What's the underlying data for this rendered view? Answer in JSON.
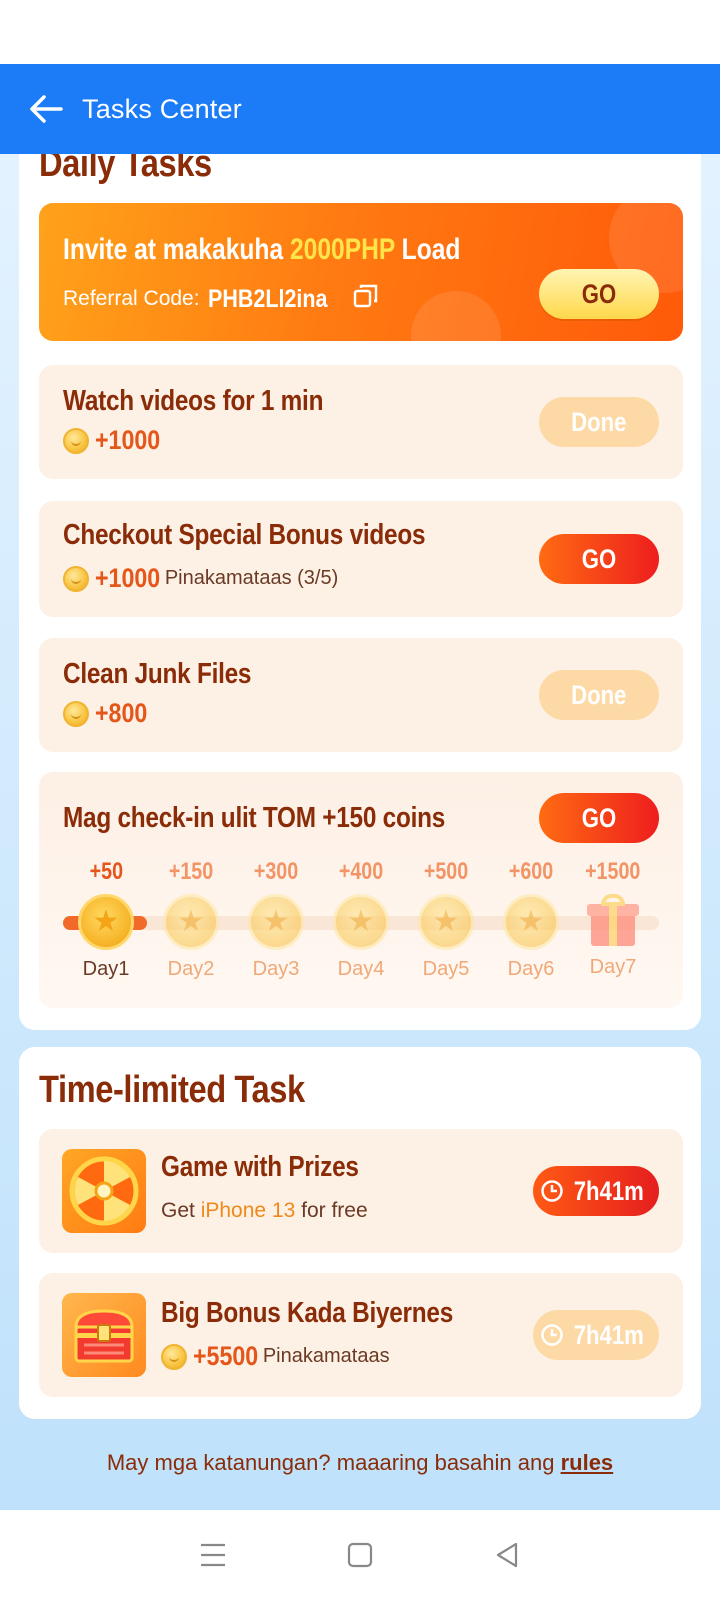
{
  "header": {
    "title": "Tasks Center"
  },
  "daily": {
    "title": "Daily Tasks",
    "invite": {
      "title_prefix": "Invite at makakuha ",
      "title_highlight": "2000PHP",
      "title_suffix": " Load",
      "ref_label": "Referral Code:",
      "ref_code": "PHB2Ll2ina",
      "button": "GO"
    },
    "tasks": [
      {
        "title": "Watch videos for 1 min",
        "reward": "+1000",
        "note": "",
        "button": "Done",
        "state": "done"
      },
      {
        "title": "Checkout Special Bonus videos",
        "reward": "+1000",
        "note": "Pinakamataas (3/5)",
        "button": "GO",
        "state": "go"
      },
      {
        "title": "Clean Junk Files",
        "reward": "+800",
        "note": "",
        "button": "Done",
        "state": "done"
      }
    ],
    "checkin": {
      "title": "Mag check-in ulit TOM +150 coins",
      "button": "GO",
      "days": [
        {
          "amount": "+50",
          "label": "Day1"
        },
        {
          "amount": "+150",
          "label": "Day2"
        },
        {
          "amount": "+300",
          "label": "Day3"
        },
        {
          "amount": "+400",
          "label": "Day4"
        },
        {
          "amount": "+500",
          "label": "Day5"
        },
        {
          "amount": "+600",
          "label": "Day6"
        },
        {
          "amount": "+1500",
          "label": "Day7"
        }
      ],
      "completed_days": 1
    }
  },
  "limited": {
    "title": "Time-limited Task",
    "tasks": [
      {
        "title": "Game with Prizes",
        "sub_prefix": "Get ",
        "sub_highlight": "iPhone 13",
        "sub_suffix": " for free",
        "timer": "7h41m",
        "icon": "prize-wheel-icon"
      },
      {
        "title": "Big Bonus Kada Biyernes",
        "reward": "+5500",
        "note": "Pinakamataas",
        "timer": "7h41m",
        "icon": "treasure-chest-icon"
      }
    ]
  },
  "footer": {
    "question": "May mga katanungan? maaaring basahin ang ",
    "rules": "rules"
  },
  "colors": {
    "header_blue": "#1c7cf7",
    "title_brown": "#8a2c08",
    "accent_orange": "#ff6b12"
  }
}
